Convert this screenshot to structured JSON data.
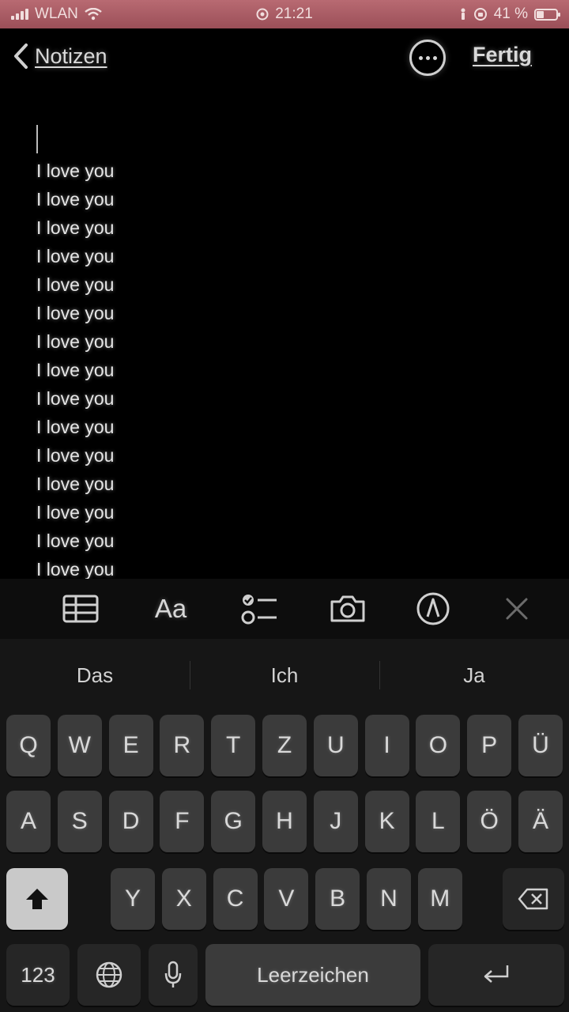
{
  "status_bar": {
    "carrier": "WLAN",
    "time": "21:21",
    "battery": "41 %",
    "battery_level": 0.41
  },
  "nav": {
    "back_label": "Notizen",
    "done_label": "Fertig"
  },
  "note": {
    "lines": [
      "I love you",
      "I love you",
      "I love you",
      "I love you",
      "I love you",
      "I love you",
      "I love you",
      "I love you",
      "I love you",
      "I love you",
      "I love you",
      "I love you",
      "I love you",
      "I love you",
      "I love you"
    ]
  },
  "toolbar": {
    "format_label": "Aa",
    "icons": [
      "table-icon",
      "format-icon",
      "checklist-icon",
      "camera-icon",
      "markup-icon",
      "close-icon"
    ]
  },
  "keyboard": {
    "suggestions": [
      "Das",
      "Ich",
      "Ja"
    ],
    "row1": [
      "Q",
      "W",
      "E",
      "R",
      "T",
      "Z",
      "U",
      "I",
      "O",
      "P",
      "Ü"
    ],
    "row2": [
      "A",
      "S",
      "D",
      "F",
      "G",
      "H",
      "J",
      "K",
      "L",
      "Ö",
      "Ä"
    ],
    "row3": [
      "Y",
      "X",
      "C",
      "V",
      "B",
      "N",
      "M"
    ],
    "numbers_label": "123",
    "space_label": "Leerzeichen"
  }
}
